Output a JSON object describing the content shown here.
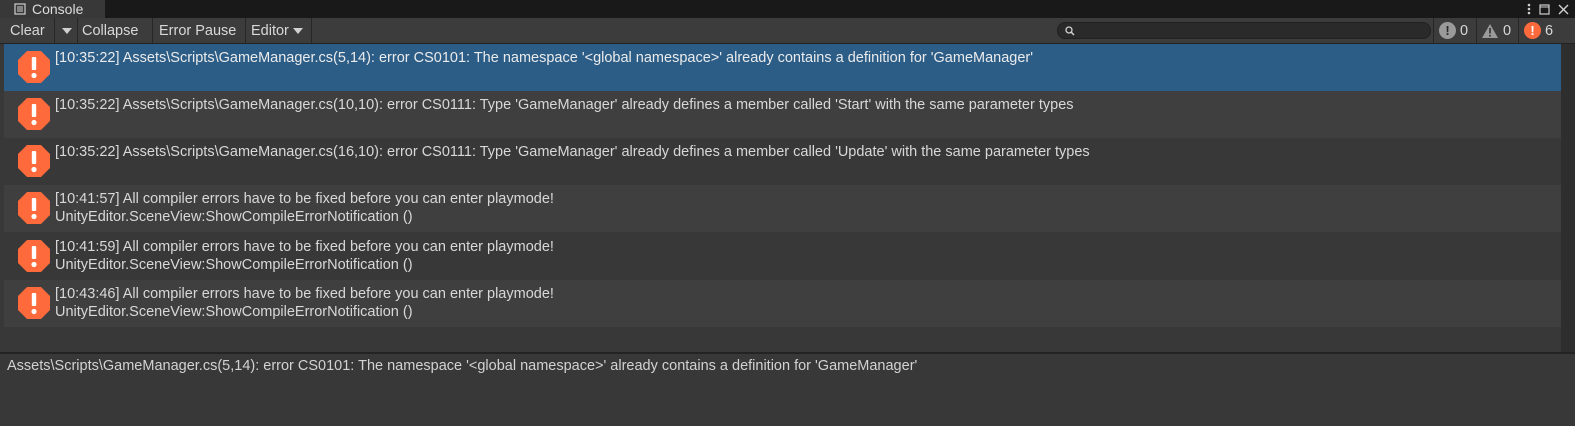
{
  "window": {
    "tab_title": "Console",
    "tab_icon": "console-list-icon",
    "controls": [
      "more-vertical-icon",
      "maximize-icon",
      "close-icon"
    ]
  },
  "toolbar": {
    "clear_label": "Clear",
    "collapse_label": "Collapse",
    "error_pause_label": "Error Pause",
    "editor_label": "Editor",
    "search": {
      "value": "",
      "placeholder": ""
    },
    "counts": {
      "info": "0",
      "warnings": "0",
      "errors": "6"
    }
  },
  "colors": {
    "error_accent": "#ff6a3d",
    "selection": "#2c5d87",
    "background": "#383838"
  },
  "logs": [
    {
      "line1": "[10:35:22] Assets\\Scripts\\GameManager.cs(5,14): error CS0101: The namespace '<global namespace>' already contains a definition for 'GameManager'",
      "line2": "",
      "selected": true
    },
    {
      "line1": "[10:35:22] Assets\\Scripts\\GameManager.cs(10,10): error CS0111: Type 'GameManager' already defines a member called 'Start' with the same parameter types",
      "line2": "",
      "selected": false
    },
    {
      "line1": "[10:35:22] Assets\\Scripts\\GameManager.cs(16,10): error CS0111: Type 'GameManager' already defines a member called 'Update' with the same parameter types",
      "line2": "",
      "selected": false
    },
    {
      "line1": "[10:41:57] All compiler errors have to be fixed before you can enter playmode!",
      "line2": "UnityEditor.SceneView:ShowCompileErrorNotification ()",
      "selected": false
    },
    {
      "line1": "[10:41:59] All compiler errors have to be fixed before you can enter playmode!",
      "line2": "UnityEditor.SceneView:ShowCompileErrorNotification ()",
      "selected": false
    },
    {
      "line1": "[10:43:46] All compiler errors have to be fixed before you can enter playmode!",
      "line2": "UnityEditor.SceneView:ShowCompileErrorNotification ()",
      "selected": false
    }
  ],
  "details": {
    "text": "Assets\\Scripts\\GameManager.cs(5,14): error CS0101: The namespace '<global namespace>' already contains a definition for 'GameManager'"
  }
}
